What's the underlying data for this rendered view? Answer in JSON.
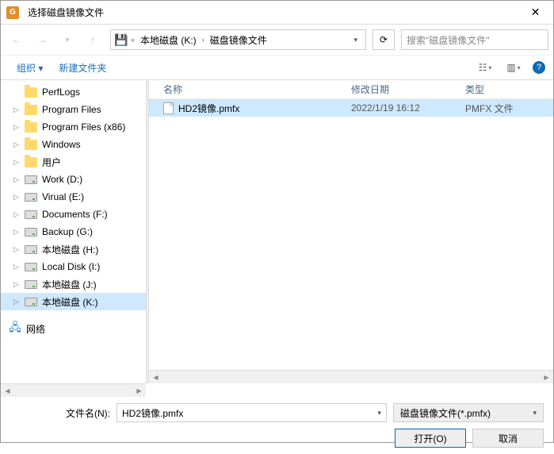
{
  "title": "选择磁盘镜像文件",
  "breadcrumb": {
    "root_chev": "«",
    "part1": "本地磁盘 (K:)",
    "part2": "磁盘镜像文件"
  },
  "search": {
    "placeholder": "搜索\"磁盘镜像文件\""
  },
  "toolbar": {
    "organize": "组织 ▾",
    "newfolder": "新建文件夹"
  },
  "tree": [
    {
      "type": "folder",
      "label": "PerfLogs",
      "expandable": false
    },
    {
      "type": "folder",
      "label": "Program Files",
      "expandable": true
    },
    {
      "type": "folder",
      "label": "Program Files (x86)",
      "expandable": true
    },
    {
      "type": "folder",
      "label": "Windows",
      "expandable": true
    },
    {
      "type": "folder",
      "label": "用户",
      "expandable": true
    },
    {
      "type": "drive",
      "label": "Work (D:)",
      "expandable": true
    },
    {
      "type": "drive",
      "label": "Virual (E:)",
      "expandable": true
    },
    {
      "type": "drive",
      "label": "Documents (F:)",
      "expandable": true
    },
    {
      "type": "drive",
      "label": "Backup (G:)",
      "expandable": true
    },
    {
      "type": "drive",
      "label": "本地磁盘 (H:)",
      "expandable": true
    },
    {
      "type": "drive",
      "label": "Local Disk (I:)",
      "expandable": true
    },
    {
      "type": "drive",
      "label": "本地磁盘 (J:)",
      "expandable": true
    },
    {
      "type": "drive",
      "label": "本地磁盘 (K:)",
      "expandable": true,
      "selected": true
    },
    {
      "type": "network",
      "label": "网络",
      "lvl0": true,
      "expandable": true
    }
  ],
  "columns": {
    "name": "名称",
    "date": "修改日期",
    "type": "类型"
  },
  "files": [
    {
      "name": "HD2镜像.pmfx",
      "date": "2022/1/19 16:12",
      "type": "PMFX 文件",
      "selected": true
    }
  ],
  "bottom": {
    "fn_label": "文件名(N):",
    "fn_value": "HD2镜像.pmfx",
    "filter": "磁盘镜像文件(*.pmfx)",
    "open": "打开(O)",
    "cancel": "取消"
  }
}
